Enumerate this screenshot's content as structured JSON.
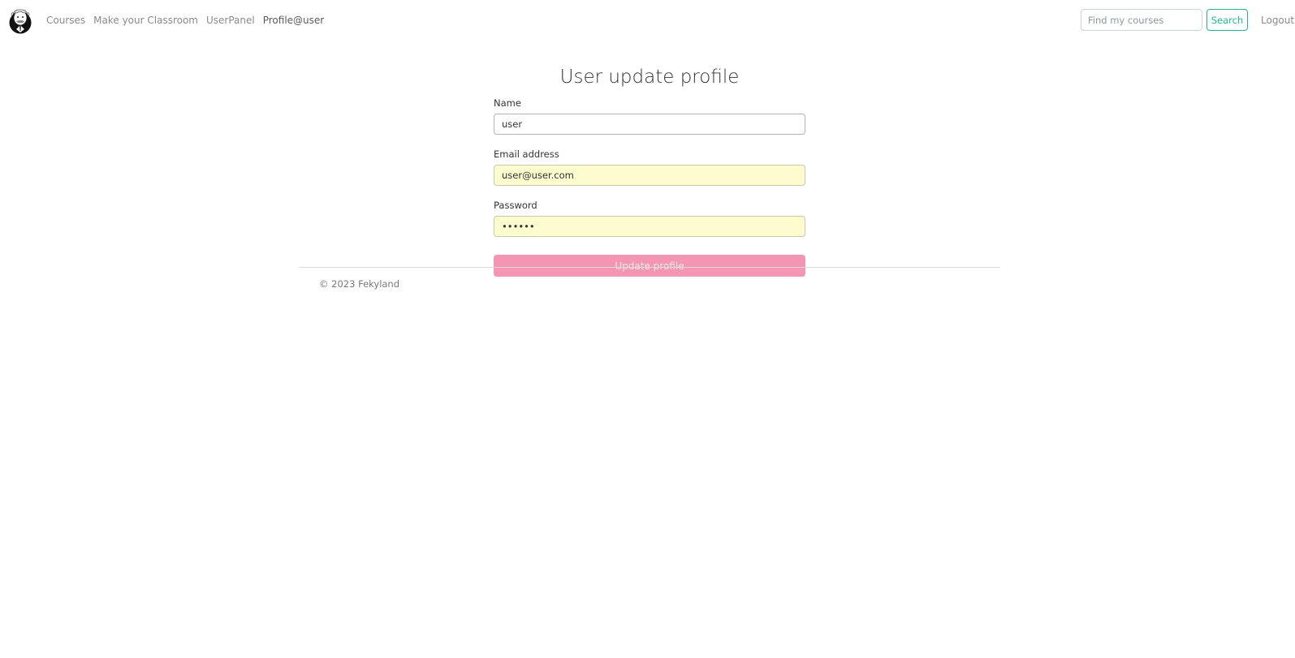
{
  "nav": {
    "logo_icon": "profile-portrait-logo",
    "links": [
      {
        "label": "Courses",
        "active": false
      },
      {
        "label": "Make your Classroom",
        "active": false
      },
      {
        "label": "UserPanel",
        "active": false
      },
      {
        "label": "Profile@user",
        "active": true
      }
    ],
    "search_placeholder": "Find my courses",
    "search_value": "",
    "search_button_label": "Search",
    "logout_label": "Logout"
  },
  "form": {
    "title": "User update profile",
    "name_label": "Name",
    "name_value": "user",
    "email_label": "Email address",
    "email_value": "user@user.com",
    "password_label": "Password",
    "password_value": "••••••",
    "submit_label": "Update profile"
  },
  "footer": {
    "text": "© 2023 Fekyland"
  },
  "colors": {
    "accent": "#22b591",
    "button": "#f395b3",
    "autofill": "#fcfccf"
  }
}
